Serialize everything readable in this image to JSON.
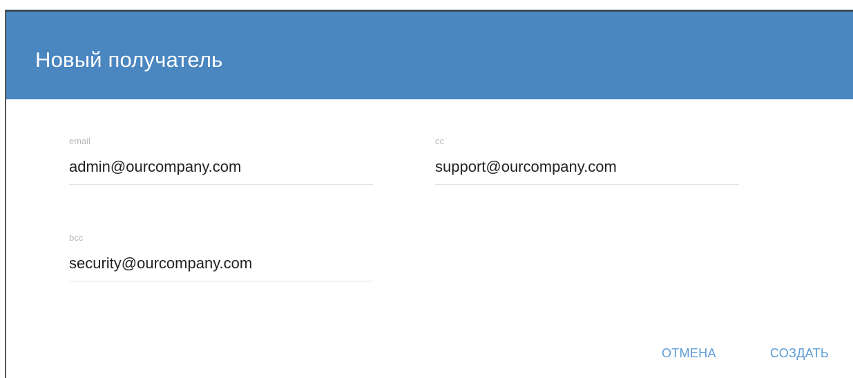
{
  "dialog": {
    "title": "Новый получатель",
    "colors": {
      "header_bg": "#4a86c0",
      "title_text": "#ffffff",
      "action_text": "#5b9bd5"
    }
  },
  "fields": {
    "email": {
      "label": "email",
      "value": "admin@ourcompany.com"
    },
    "cc": {
      "label": "cc",
      "value": "support@ourcompany.com"
    },
    "bcc": {
      "label": "bcc",
      "value": "security@ourcompany.com"
    }
  },
  "actions": {
    "cancel_label": "ОТМЕНА",
    "create_label": "СОЗДАТЬ"
  }
}
